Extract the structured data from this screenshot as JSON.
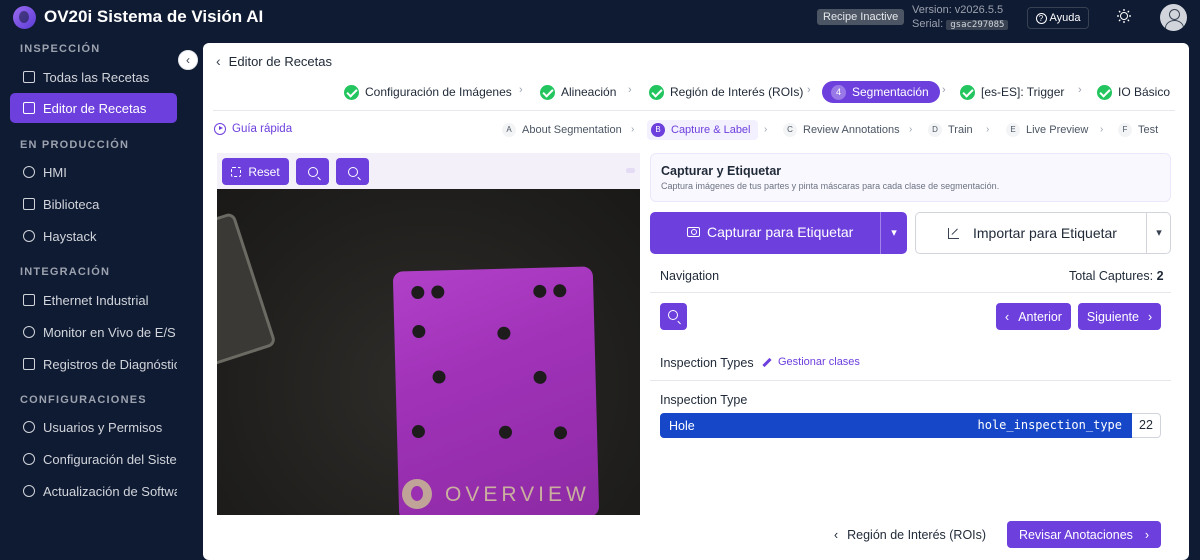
{
  "app": {
    "title": "OV20i Sistema de Visión AI",
    "recipe_status": "Recipe Inactive",
    "version": "Version: v2026.5.5",
    "serial_label": "Serial:",
    "serial_value": "gsac297085",
    "help_label": "Ayuda",
    "icons": [
      "logo-icon",
      "help-icon",
      "sun-icon",
      "user-avatar-icon"
    ]
  },
  "sidebar": {
    "sections": [
      {
        "title": "INSPECCIÓN",
        "items": [
          {
            "label": "Todas las Recetas",
            "icon": "list-icon"
          },
          {
            "label": "Editor de Recetas",
            "icon": "edit-icon",
            "active": true
          }
        ]
      },
      {
        "title": "EN PRODUCCIÓN",
        "items": [
          {
            "label": "HMI",
            "icon": "eye-icon"
          },
          {
            "label": "Biblioteca",
            "icon": "grid-icon"
          },
          {
            "label": "Haystack",
            "icon": "search-icon"
          }
        ]
      },
      {
        "title": "INTEGRACIÓN",
        "items": [
          {
            "label": "Ethernet Industrial",
            "icon": "network-icon"
          },
          {
            "label": "Monitor en Vivo de E/S",
            "icon": "monitor-icon"
          },
          {
            "label": "Registros de Diagnóstico",
            "icon": "log-icon"
          }
        ]
      },
      {
        "title": "CONFIGURACIONES",
        "items": [
          {
            "label": "Usuarios y Permisos",
            "icon": "user-icon"
          },
          {
            "label": "Configuración del Sistema",
            "icon": "gear-icon"
          },
          {
            "label": "Actualización de Software",
            "icon": "refresh-icon"
          }
        ]
      }
    ],
    "collapse_icon": "chevron-left-icon"
  },
  "editor": {
    "back_label": "Editor de Recetas",
    "steps": [
      {
        "label": "Configuración de Imágenes",
        "done": true
      },
      {
        "label": "Alineación",
        "done": true
      },
      {
        "label": "Región de Interés (ROIs)",
        "done": true
      },
      {
        "label": "Segmentación",
        "number": "4",
        "active": true
      },
      {
        "label": "[es-ES]: Trigger",
        "done": true
      },
      {
        "label": "IO Básico",
        "done": true
      }
    ],
    "guide_label": "Guía rápida",
    "substeps": [
      {
        "letter": "A",
        "label": "About Segmentation"
      },
      {
        "letter": "B",
        "label": "Capture & Label",
        "active": true
      },
      {
        "letter": "C",
        "label": "Review Annotations"
      },
      {
        "letter": "D",
        "label": "Train"
      },
      {
        "letter": "E",
        "label": "Live Preview"
      },
      {
        "letter": "F",
        "label": "Test"
      }
    ]
  },
  "image_toolbar": {
    "reset_label": "Reset",
    "zoom_out_icon": "zoom-out-icon",
    "zoom_in_icon": "zoom-in-icon"
  },
  "camera_view": {
    "plate_text": "OVERVIEW"
  },
  "capture_panel": {
    "title": "Capturar y Etiquetar",
    "description": "Captura imágenes de tus partes y pinta máscaras para cada clase de segmentación.",
    "capture_label": "Capturar para Etiquetar",
    "import_label": "Importar para Etiquetar",
    "navigation_title": "Navigation",
    "total_label": "Total Captures:",
    "total_value": "2",
    "prev_label": "Anterior",
    "next_label": "Siguiente",
    "inspection_types_title": "Inspection Types",
    "manage_label": "Gestionar clases",
    "inspection_type_label": "Inspection Type",
    "types": [
      {
        "name": "Hole",
        "key": "hole_inspection_type",
        "count": "22"
      }
    ]
  },
  "footer": {
    "prev_label": "Región de Interés (ROIs)",
    "next_label": "Revisar Anotaciones"
  },
  "colors": {
    "accent": "#6d3fdd",
    "sidebar_bg": "#0f1a33",
    "success": "#22c55e",
    "selected_row": "#1547c8"
  }
}
